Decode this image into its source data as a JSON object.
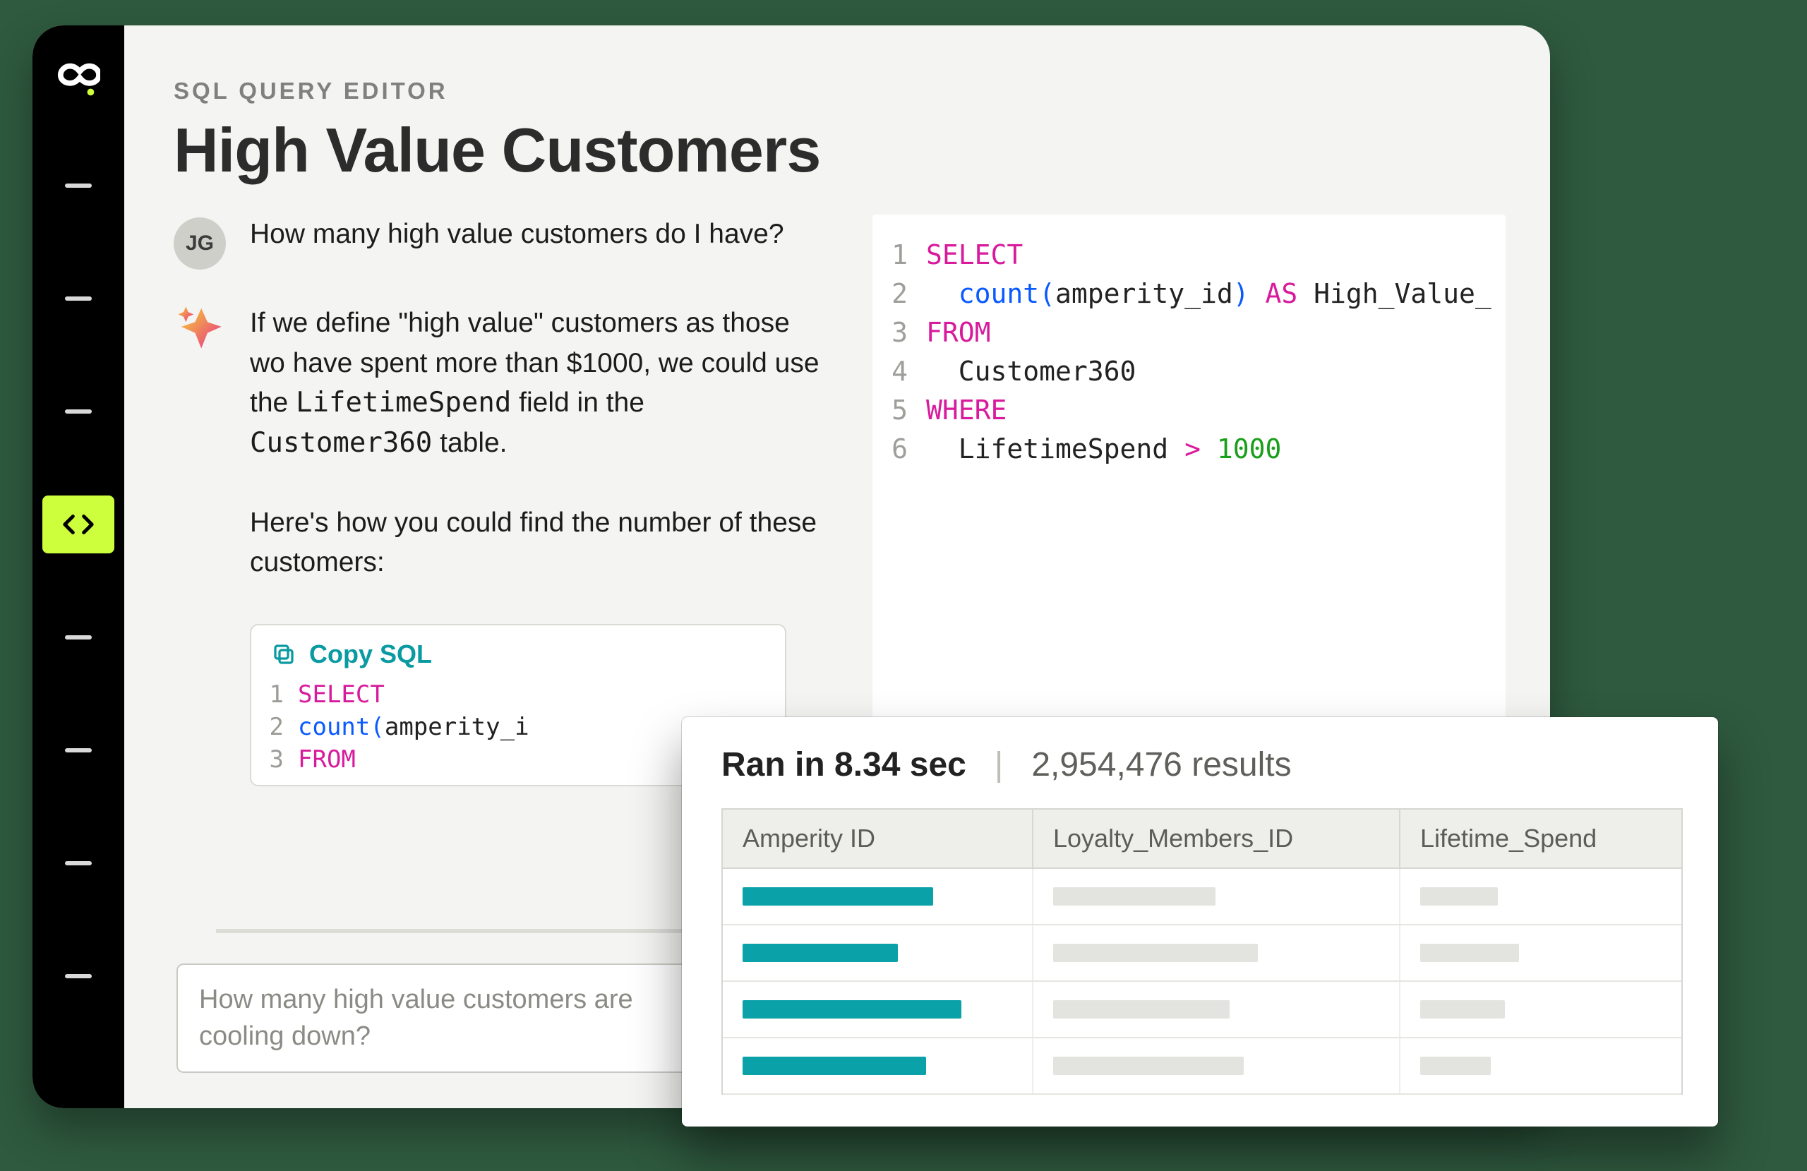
{
  "header": {
    "eyebrow": "SQL QUERY EDITOR",
    "title": "High Value Customers"
  },
  "sidebar": {
    "nav_count": 8,
    "active_index": 3
  },
  "chat": {
    "user": {
      "initials": "JG",
      "text": "How many high value customers do I have?"
    },
    "ai": {
      "para1_pre": "If we define \"high value\" customers as those wo have spent more than $1000, we could use the ",
      "code1": "LifetimeSpend",
      "mid1": " field in the ",
      "code2": "Customer360",
      "post1": " table.",
      "para2": "Here's how you could find the number of these customers:"
    },
    "copy_label": "Copy SQL",
    "mini_sql": [
      {
        "n": "1",
        "html": "<span class='kw'>SELECT</span>"
      },
      {
        "n": "2",
        "html": "  <span class='func'>count</span><span class='paren'>(</span><span class='id'>amperity_i</span>"
      },
      {
        "n": "3",
        "html": "<span class='kw'>FROM</span>"
      }
    ]
  },
  "prompt": {
    "placeholder": "How many high value customers are cooling down?"
  },
  "editor": {
    "lines": [
      {
        "n": "1",
        "html": "<span class='kw'>SELECT</span>"
      },
      {
        "n": "2",
        "html": "  <span class='func'>count</span><span class='paren'>(</span><span class='id'>amperity_id</span><span class='paren'>)</span> <span class='kw2'>AS</span> <span class='id'>High_Value_</span>"
      },
      {
        "n": "3",
        "html": "<span class='kw'>FROM</span>"
      },
      {
        "n": "4",
        "html": "  <span class='id'>Customer360</span>"
      },
      {
        "n": "5",
        "html": "<span class='kw'>WHERE</span>"
      },
      {
        "n": "6",
        "html": "  <span class='id'>LifetimeSpend</span> <span class='op'>&gt;</span> <span class='num'>1000</span>"
      }
    ]
  },
  "results": {
    "ran_label": "Ran in 8.34 sec",
    "count_label": "2,954,476 results",
    "columns": [
      "Amperity ID",
      "Loyalty_Members_ID",
      "Lifetime_Spend"
    ],
    "rows": [
      {
        "a_w": 270,
        "b_w": 230,
        "c_w": 110
      },
      {
        "a_w": 220,
        "b_w": 290,
        "c_w": 140
      },
      {
        "a_w": 310,
        "b_w": 250,
        "c_w": 120
      },
      {
        "a_w": 260,
        "b_w": 270,
        "c_w": 100
      }
    ]
  }
}
